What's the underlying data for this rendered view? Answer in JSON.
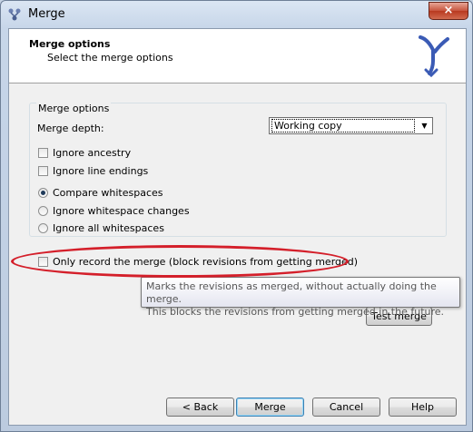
{
  "window": {
    "title": "Merge",
    "close_glyph": "×"
  },
  "header": {
    "title": "Merge options",
    "subtitle": "Select the merge options"
  },
  "group": {
    "title": "Merge options",
    "depth_label": "Merge depth:",
    "depth_value": "Working copy",
    "checkboxes": [
      {
        "label": "Ignore ancestry",
        "checked": false
      },
      {
        "label": "Ignore line endings",
        "checked": false
      }
    ],
    "radios": [
      {
        "label": "Compare whitespaces",
        "selected": true
      },
      {
        "label": "Ignore whitespace changes",
        "selected": false
      },
      {
        "label": "Ignore all whitespaces",
        "selected": false
      }
    ]
  },
  "record_only": {
    "label": "Only record the merge (block revisions from getting merged)",
    "checked": false
  },
  "tooltip": {
    "line1": "Marks the revisions as merged, without actually doing the merge.",
    "line2": "This blocks the revisions from getting merged in the future."
  },
  "test_merge": "Test merge",
  "buttons": {
    "back": "< Back",
    "merge": "Merge",
    "cancel": "Cancel",
    "help": "Help"
  },
  "colors": {
    "highlight": "#d41f2a",
    "logo": "#3b5bb5"
  },
  "icons": {
    "app": "merge-app-icon",
    "logo": "merge-branch-icon"
  }
}
